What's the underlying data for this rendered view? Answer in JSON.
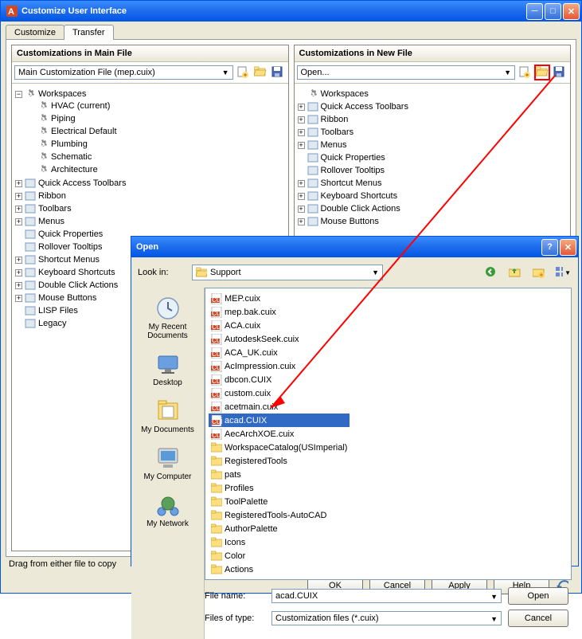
{
  "mainWindow": {
    "title": "Customize User Interface",
    "tabs": [
      "Customize",
      "Transfer"
    ],
    "activeTab": 1
  },
  "leftPane": {
    "title": "Customizations in Main File",
    "dropdown": "Main Customization File (mep.cuix)",
    "tree": {
      "workspaces": "Workspaces",
      "ws_items": [
        "HVAC (current)",
        "Piping",
        "Electrical Default",
        "Plumbing",
        "Schematic",
        "Architecture"
      ],
      "items": [
        "Quick Access Toolbars",
        "Ribbon",
        "Toolbars",
        "Menus",
        "Quick Properties",
        "Rollover Tooltips",
        "Shortcut Menus",
        "Keyboard Shortcuts",
        "Double Click Actions",
        "Mouse Buttons",
        "LISP Files",
        "Legacy"
      ]
    }
  },
  "rightPane": {
    "title": "Customizations in New File",
    "dropdown": "Open...",
    "tree": {
      "workspaces": "Workspaces",
      "items": [
        "Quick Access Toolbars",
        "Ribbon",
        "Toolbars",
        "Menus",
        "Quick Properties",
        "Rollover Tooltips",
        "Shortcut Menus",
        "Keyboard Shortcuts",
        "Double Click Actions",
        "Mouse Buttons"
      ]
    }
  },
  "footer": {
    "ok": "OK",
    "cancel": "Cancel",
    "apply": "Apply",
    "help": "Help",
    "hint": "Drag from either file to copy"
  },
  "openDialog": {
    "title": "Open",
    "lookInLabel": "Look in:",
    "lookInValue": "Support",
    "places": [
      "My Recent Documents",
      "Desktop",
      "My Documents",
      "My Computer",
      "My Network"
    ],
    "filesLeft": [
      {
        "name": "MEP.cuix",
        "type": "cuix"
      },
      {
        "name": "mep.bak.cuix",
        "type": "cuix"
      },
      {
        "name": "ACA.cuix",
        "type": "cuix"
      },
      {
        "name": "AutodeskSeek.cuix",
        "type": "cuix"
      },
      {
        "name": "ACA_UK.cuix",
        "type": "cuix"
      },
      {
        "name": "AcImpression.cuix",
        "type": "cuix"
      },
      {
        "name": "dbcon.CUIX",
        "type": "cuix"
      },
      {
        "name": "custom.cuix",
        "type": "cuix"
      },
      {
        "name": "acetmain.cuix",
        "type": "cuix"
      },
      {
        "name": "acad.CUIX",
        "type": "cuix",
        "selected": true
      },
      {
        "name": "AecArchXOE.cuix",
        "type": "cuix"
      },
      {
        "name": "WorkspaceCatalog(USImperial)",
        "type": "folder"
      },
      {
        "name": "RegisteredTools",
        "type": "folder"
      },
      {
        "name": "pats",
        "type": "folder"
      },
      {
        "name": "Profiles",
        "type": "folder"
      }
    ],
    "filesRight": [
      {
        "name": "ToolPalette",
        "type": "folder"
      },
      {
        "name": "RegisteredTools-AutoCAD",
        "type": "folder"
      },
      {
        "name": "AuthorPalette",
        "type": "folder"
      },
      {
        "name": "Icons",
        "type": "folder"
      },
      {
        "name": "Color",
        "type": "folder"
      },
      {
        "name": "Actions",
        "type": "folder"
      }
    ],
    "fileNameLabel": "File name:",
    "fileNameValue": "acad.CUIX",
    "filesTypeLabel": "Files of type:",
    "filesTypeValue": "Customization files (*.cuix)",
    "openBtn": "Open",
    "cancelBtn": "Cancel"
  }
}
